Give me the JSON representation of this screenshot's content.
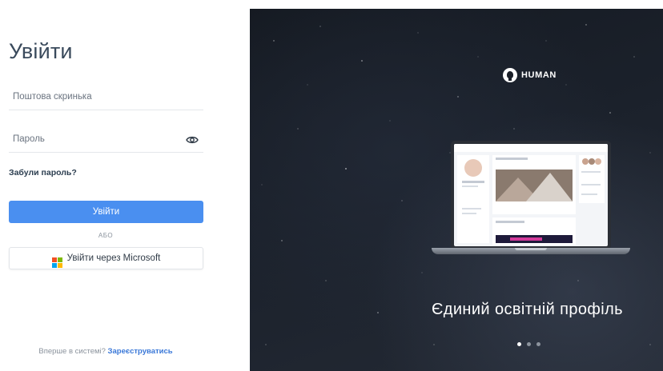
{
  "login": {
    "title": "Увійти",
    "email_placeholder": "Поштова скринька",
    "password_placeholder": "Пароль",
    "forgot_label": "Забули пароль?",
    "submit_label": "Увійти",
    "or_label": "АБО",
    "microsoft_label": "Увійти через Microsoft",
    "signup_prompt": "Вперше в системі?",
    "signup_link": "Зареєструватись"
  },
  "promo": {
    "brand": "HUMAN",
    "tagline": "Єдиний освітній профіль",
    "carousel": {
      "count": 3,
      "active": 0
    }
  },
  "colors": {
    "accent": "#4a8ff0",
    "link": "#3a78d8",
    "microsoft": [
      "#f25022",
      "#7fba00",
      "#00a4ef",
      "#ffb900"
    ]
  }
}
